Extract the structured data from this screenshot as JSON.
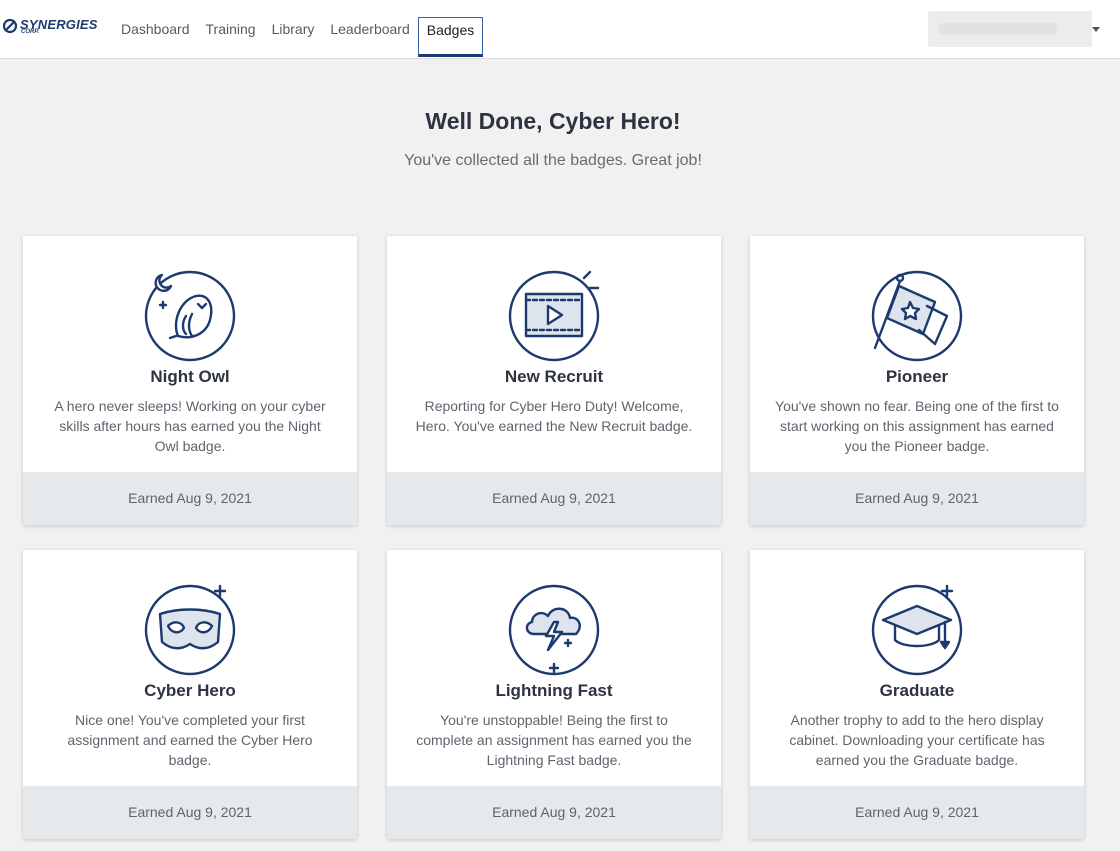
{
  "brand": {
    "name": "SYNERGIES",
    "sub": "CORP."
  },
  "nav": {
    "items": [
      {
        "label": "Dashboard"
      },
      {
        "label": "Training"
      },
      {
        "label": "Library"
      },
      {
        "label": "Leaderboard"
      },
      {
        "label": "Badges",
        "active": true
      }
    ]
  },
  "user_menu": {
    "name": ""
  },
  "header": {
    "title": "Well Done, Cyber Hero!",
    "subtitle": "You've collected all the badges. Great job!"
  },
  "badges": [
    {
      "icon": "owl-icon",
      "title": "Night Owl",
      "description": "A hero never sleeps! Working on your cyber skills after hours has earned you the Night Owl badge.",
      "earned": "Earned Aug 9, 2021"
    },
    {
      "icon": "video-icon",
      "title": "New Recruit",
      "description": "Reporting for Cyber Hero Duty! Welcome, Hero. You've earned the New Recruit badge.",
      "earned": "Earned Aug 9, 2021"
    },
    {
      "icon": "flag-icon",
      "title": "Pioneer",
      "description": "You've shown no fear. Being one of the first to start working on this assignment has earned you the Pioneer badge.",
      "earned": "Earned Aug 9, 2021"
    },
    {
      "icon": "mask-icon",
      "title": "Cyber Hero",
      "description": "Nice one! You've completed your first assignment and earned the Cyber Hero badge.",
      "earned": "Earned Aug 9, 2021"
    },
    {
      "icon": "lightning-cloud-icon",
      "title": "Lightning Fast",
      "description": "You're unstoppable! Being the first to complete an assignment has earned you the Lightning Fast badge.",
      "earned": "Earned Aug 9, 2021"
    },
    {
      "icon": "graduation-cap-icon",
      "title": "Graduate",
      "description": "Another trophy to add to the hero display cabinet. Downloading your certificate has earned you the Graduate badge.",
      "earned": "Earned Aug 9, 2021"
    }
  ],
  "colors": {
    "icon_stroke": "#1d3a6e",
    "page_bg": "#f1f1f1",
    "footer_bg": "#e6e9ec"
  }
}
